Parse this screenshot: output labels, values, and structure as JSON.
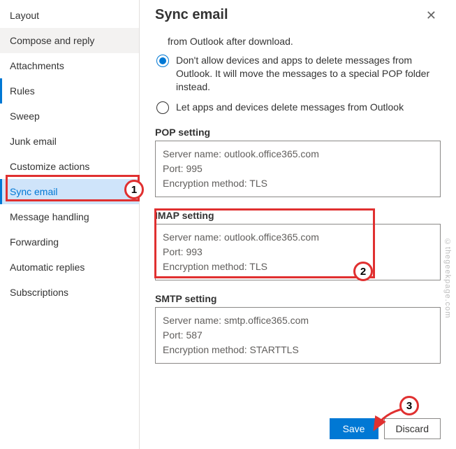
{
  "sidebar": {
    "items": [
      {
        "label": "Layout"
      },
      {
        "label": "Compose and reply"
      },
      {
        "label": "Attachments"
      },
      {
        "label": "Rules"
      },
      {
        "label": "Sweep"
      },
      {
        "label": "Junk email"
      },
      {
        "label": "Customize actions"
      },
      {
        "label": "Sync email"
      },
      {
        "label": "Message handling"
      },
      {
        "label": "Forwarding"
      },
      {
        "label": "Automatic replies"
      },
      {
        "label": "Subscriptions"
      }
    ],
    "active_index": 7
  },
  "header": {
    "title": "Sync email"
  },
  "fragment_text": "from Outlook after download.",
  "radio": {
    "option1": "Don't allow devices and apps to delete messages from Outlook. It will move the messages to a special POP folder instead.",
    "option2": "Let apps and devices delete messages from Outlook",
    "selected": 0
  },
  "pop": {
    "heading": "POP setting",
    "server_label": "Server name:",
    "server": "outlook.office365.com",
    "port_label": "Port:",
    "port": "995",
    "enc_label": "Encryption method:",
    "enc": "TLS"
  },
  "imap": {
    "heading": "IMAP setting",
    "server_label": "Server name:",
    "server": "outlook.office365.com",
    "port_label": "Port:",
    "port": "993",
    "enc_label": "Encryption method:",
    "enc": "TLS"
  },
  "smtp": {
    "heading": "SMTP setting",
    "server_label": "Server name:",
    "server": "smtp.office365.com",
    "port_label": "Port:",
    "port": "587",
    "enc_label": "Encryption method:",
    "enc": "STARTTLS"
  },
  "buttons": {
    "save": "Save",
    "discard": "Discard"
  },
  "annotations": {
    "b1": "1",
    "b2": "2",
    "b3": "3"
  },
  "watermark": "©thegeekpage.com"
}
